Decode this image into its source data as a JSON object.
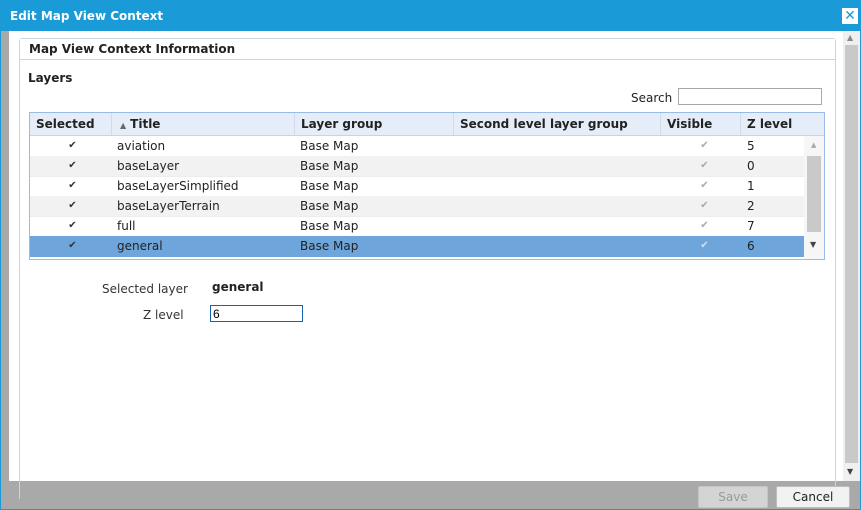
{
  "dialog": {
    "title": "Edit Map View Context",
    "close_glyph": "✕"
  },
  "panel": {
    "header": "Map View Context Information",
    "layers_label": "Layers"
  },
  "search": {
    "label": "Search",
    "value": ""
  },
  "grid": {
    "columns": [
      "Selected",
      "Title",
      "Layer group",
      "Second level layer group",
      "Visible",
      "Z level"
    ],
    "sort_glyph": "▲",
    "rows": [
      {
        "selected": true,
        "title": "aviation",
        "group": "Base Map",
        "second_group": "",
        "visible": true,
        "z": "5"
      },
      {
        "selected": true,
        "title": "baseLayer",
        "group": "Base Map",
        "second_group": "",
        "visible": true,
        "z": "0"
      },
      {
        "selected": true,
        "title": "baseLayerSimplified",
        "group": "Base Map",
        "second_group": "",
        "visible": true,
        "z": "1"
      },
      {
        "selected": true,
        "title": "baseLayerTerrain",
        "group": "Base Map",
        "second_group": "",
        "visible": true,
        "z": "2"
      },
      {
        "selected": true,
        "title": "full",
        "group": "Base Map",
        "second_group": "",
        "visible": true,
        "z": "7"
      },
      {
        "selected": true,
        "title": "general",
        "group": "Base Map",
        "second_group": "",
        "visible": true,
        "z": "6"
      }
    ],
    "highlighted_row": "general"
  },
  "details": {
    "selected_layer_label": "Selected layer",
    "selected_layer_value": "general",
    "z_level_label": "Z level",
    "z_level_value": "6"
  },
  "footer": {
    "save_label": "Save",
    "cancel_label": "Cancel"
  },
  "icons": {
    "check": "✔",
    "scroll_up": "▲",
    "scroll_down": "▼"
  },
  "colors": {
    "title_bar": "#1a9ad6",
    "selected_row": "#6ea5db",
    "header_row": "#e5eef8"
  }
}
